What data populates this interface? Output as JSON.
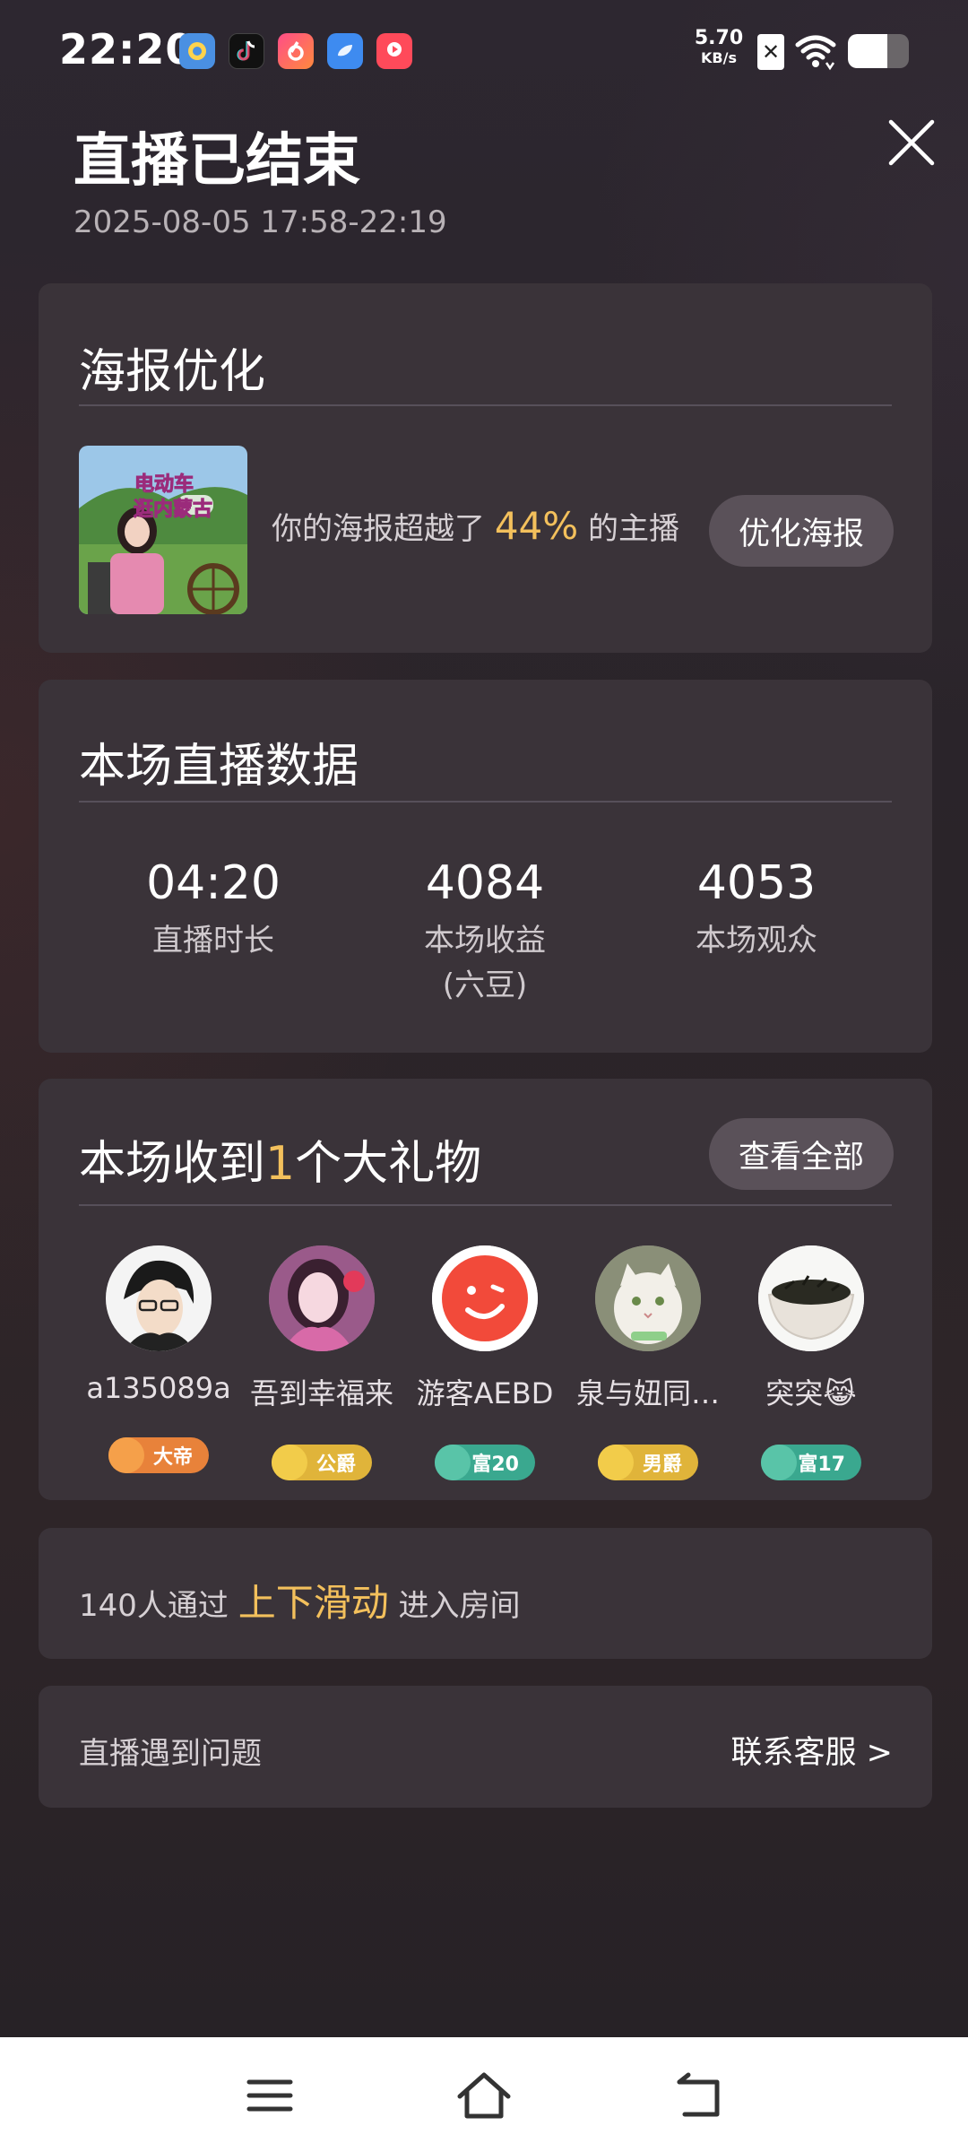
{
  "status_bar": {
    "time": "22:20",
    "app_icons": [
      "quark-icon",
      "tiktok-icon",
      "liuliu-icon",
      "cloud-app-icon",
      "video-app-icon"
    ],
    "network_speed_value": "5.70",
    "network_speed_unit": "KB/s",
    "battery_level": 0.65
  },
  "header": {
    "title": "直播已结束",
    "time_range": "2025-08-05 17:58-22:19"
  },
  "poster": {
    "title": "海报优化",
    "text_before": "你的海报超越了",
    "percent": "44%",
    "text_after": "的主播",
    "button": "优化海报",
    "thumb_text_1": "电动车",
    "thumb_text_2": "逛内蒙古"
  },
  "stats": {
    "title": "本场直播数据",
    "items": [
      {
        "value": "04:20",
        "label": "直播时长"
      },
      {
        "value": "4084",
        "label": "本场收益",
        "sublabel": "(六豆)"
      },
      {
        "value": "4053",
        "label": "本场观众"
      }
    ]
  },
  "gifts": {
    "title_before": "本场收到",
    "count": "1",
    "title_after": "个大礼物",
    "button": "查看全部",
    "gifters": [
      {
        "name": "a135089a",
        "badge": "大帝"
      },
      {
        "name": "吾到幸福来",
        "badge": "公爵"
      },
      {
        "name": "游客AEBD",
        "badge": "富20"
      },
      {
        "name": "泉与妞同…",
        "badge": "男爵"
      },
      {
        "name": "突突😹",
        "badge": "富17"
      }
    ]
  },
  "slide": {
    "text_before": "140人通过",
    "highlight": "上下滑动",
    "text_after": "进入房间"
  },
  "help": {
    "left": "直播遇到问题",
    "right": "联系客服 >"
  },
  "colors": {
    "accent": "#f3c05c",
    "card": "#3a3339",
    "button": "#5a5159"
  }
}
